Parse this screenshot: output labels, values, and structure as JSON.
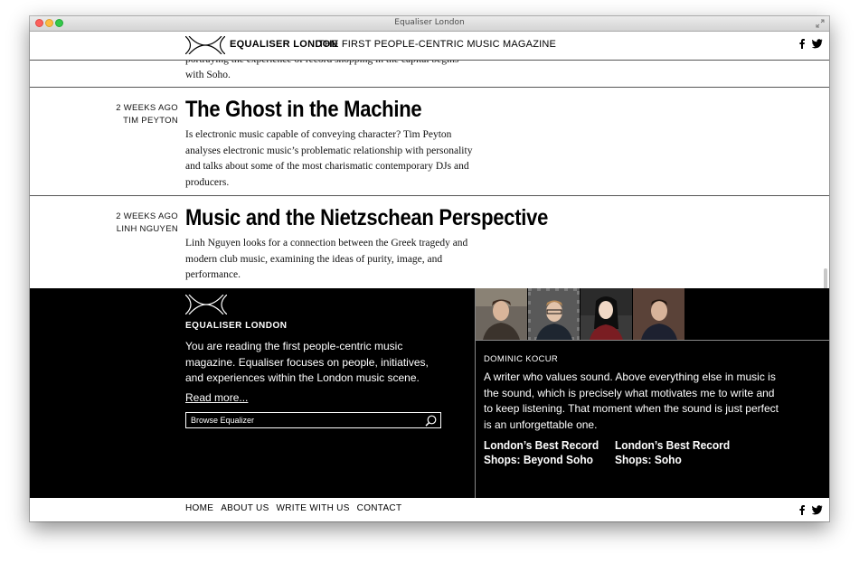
{
  "window": {
    "title": "Equaliser London"
  },
  "header": {
    "brand": "EQUALISER LONDON",
    "tagline": "THE FIRST PEOPLE-CENTRIC MUSIC MAGAZINE",
    "social": [
      "facebook-icon",
      "twitter-icon"
    ]
  },
  "articles": {
    "previous_text": "portraying the experience of record shopping in the capital begins with Soho.",
    "items": [
      {
        "date": "2 WEEKS AGO",
        "author": "TIM PEYTON",
        "title": "The Ghost in the Machine",
        "excerpt": "Is electronic music capable of conveying character? Tim Peyton analyses electronic music’s problematic relationship with personality and talks about some of the most charismatic contemporary DJs and producers."
      },
      {
        "date": "2 WEEKS AGO",
        "author": "LINH NGUYEN",
        "title": "Music and the Nietzschean Perspective",
        "excerpt": "Linh Nguyen looks for a connection between the Greek tragedy and modern club music, examining the ideas of purity, image, and performance."
      }
    ]
  },
  "about": {
    "brand": "EQUALISER LONDON",
    "description": "You are reading the first people-centric music magazine. Equaliser focuses on people, initiatives, and experiences within the London music scene.",
    "read_more": "Read more...",
    "search_placeholder": "Browse Equalizer"
  },
  "writer": {
    "name": "DOMINIC KOCUR",
    "bio": "A writer who values sound. Above everything else in music is the sound, which is precisely what motivates me to write and to keep listening. That moment when the sound is just perfect is an unforgettable one.",
    "related": [
      "London’s Best Record Shops: Beyond Soho",
      "London’s Best Record Shops: Soho"
    ]
  },
  "footer": {
    "nav": [
      "HOME",
      "ABOUT US",
      "WRITE WITH US",
      "CONTACT"
    ]
  },
  "colors": {
    "background": "#ffffff",
    "panel": "#000000",
    "text": "#000000"
  }
}
